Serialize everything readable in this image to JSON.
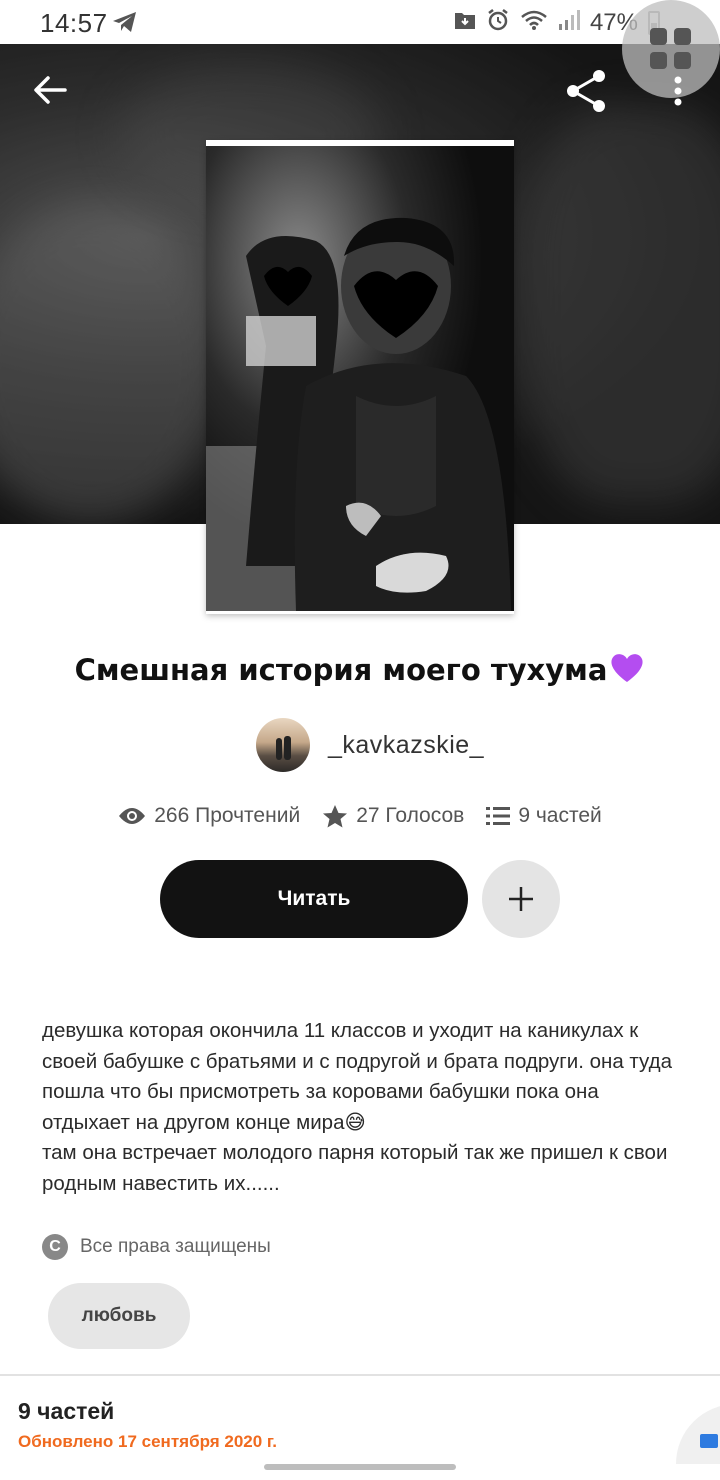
{
  "status_bar": {
    "time": "14:57",
    "battery": "47%",
    "icons": [
      "telegram-icon",
      "save-icon",
      "alarm-icon",
      "wifi-icon",
      "signal-icon",
      "battery-icon"
    ]
  },
  "header": {
    "back_icon": "arrow-left-icon",
    "share_icon": "share-icon",
    "more_icon": "more-vertical-icon",
    "floating_icon": "grid-icon"
  },
  "story": {
    "title": "Смешная история моего тухума",
    "author": "_kavkazskie_",
    "stats": {
      "reads": "266 Прочтений",
      "votes": "27 Голосов",
      "parts": "9 частей"
    },
    "read_label": "Читать",
    "description": "девушка которая окончила 11 классов и уходит на каникулах к своей бабушке с братьями и с подругой и брата подруги. она туда пошла что бы присмотреть за коровами бабушки пока она отдыхает на другом конце мира😅\nтам она встречает молодого парня который так же пришел к свои родным навестить их......",
    "rights": "Все права защищены",
    "tag": "любовь"
  },
  "footer": {
    "parts_title": "9 частей",
    "updated": "Обновлено 17 сентября 2020 г."
  },
  "colors": {
    "accent_orange": "#f06a1f",
    "button_dark": "#121212",
    "heart_purple": "#b44df0"
  }
}
